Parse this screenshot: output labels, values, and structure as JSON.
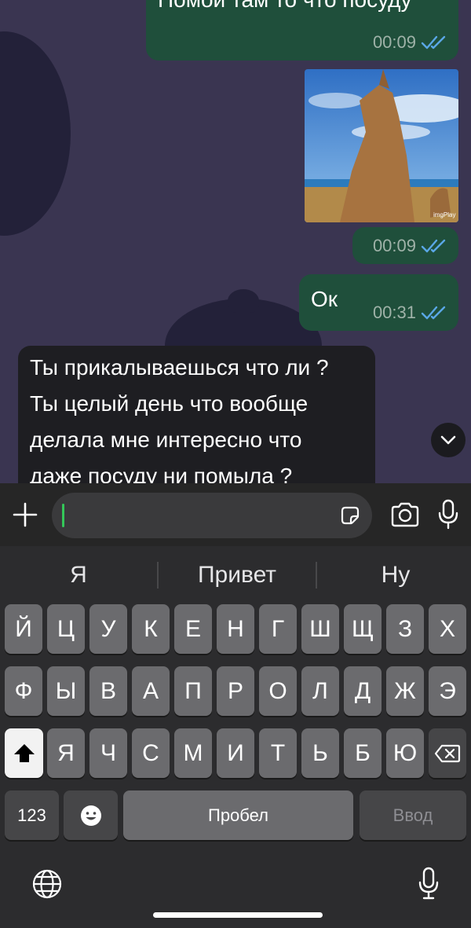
{
  "messages": [
    {
      "text": "Помой там то что посуду",
      "time": "00:09",
      "status": "read"
    },
    {
      "type": "media",
      "watermark": "imgPlay",
      "time": "00:09",
      "status": "read"
    },
    {
      "text": "Ок",
      "time": "00:31",
      "status": "read"
    },
    {
      "lines": [
        "Ты прикалываешься что ли ?",
        "Ты целый день что вообще",
        "делала мне интересно что",
        "даже посуду ни помыла ?"
      ]
    }
  ],
  "colors": {
    "chat_bg": "#3a3551",
    "outgoing_bubble": "#1f4f3b",
    "incoming_bubble": "#1e1e22",
    "read_ticks": "#5aa7e6",
    "caret": "#34c759"
  },
  "icons": {
    "attach": "plus-icon",
    "sticker": "sticker-icon",
    "camera": "camera-icon",
    "mic": "microphone-icon",
    "scroll": "chevron-down-icon",
    "globe": "globe-icon",
    "dictation": "microphone-icon",
    "emoji": "emoji-icon",
    "shift": "shift-icon",
    "backspace": "backspace-icon"
  },
  "keyboard": {
    "suggestions": [
      "Я",
      "Привет",
      "Ну"
    ],
    "row1": [
      "Й",
      "Ц",
      "У",
      "К",
      "Е",
      "Н",
      "Г",
      "Ш",
      "Щ",
      "З",
      "Х"
    ],
    "row2": [
      "Ф",
      "Ы",
      "В",
      "А",
      "П",
      "Р",
      "О",
      "Л",
      "Д",
      "Ж",
      "Э"
    ],
    "row3": [
      "Я",
      "Ч",
      "С",
      "М",
      "И",
      "Т",
      "Ь",
      "Б",
      "Ю"
    ],
    "numbers_label": "123",
    "space_label": "Пробел",
    "enter_label": "Ввод"
  }
}
